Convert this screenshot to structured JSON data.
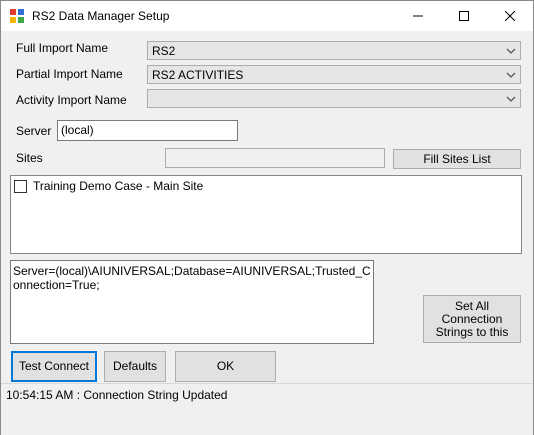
{
  "window": {
    "title": "RS2 Data Manager Setup"
  },
  "form": {
    "full_import_label": "Full Import Name",
    "full_import_value": "RS2",
    "partial_import_label": "Partial Import Name",
    "partial_import_value": "RS2 ACTIVITIES",
    "activity_import_label": "Activity Import Name",
    "activity_import_value": "",
    "server_label": "Server",
    "server_value": "(local)",
    "sites_label": "Sites",
    "sites_value": "",
    "fill_sites_label": "Fill Sites List"
  },
  "sites_list": {
    "items": [
      {
        "label": "Training Demo Case - Main Site",
        "checked": false
      }
    ]
  },
  "connection": {
    "text": "Server=(local)\\AIUNIVERSAL;Database=AIUNIVERSAL;Trusted_Connection=True;",
    "set_all_label": "Set All Connection Strings to this"
  },
  "buttons": {
    "test_connect": "Test Connect",
    "defaults": "Defaults",
    "ok": "OK"
  },
  "status": {
    "message": "10:54:15 AM : Connection String Updated"
  },
  "icons": {
    "app": "app-icon",
    "minimize": "minimize-icon",
    "maximize": "maximize-icon",
    "close": "close-icon",
    "dropdown": "chevron-down-icon"
  },
  "colors": {
    "focus_border": "#0078d7",
    "window_bg": "#f0f0f0"
  }
}
